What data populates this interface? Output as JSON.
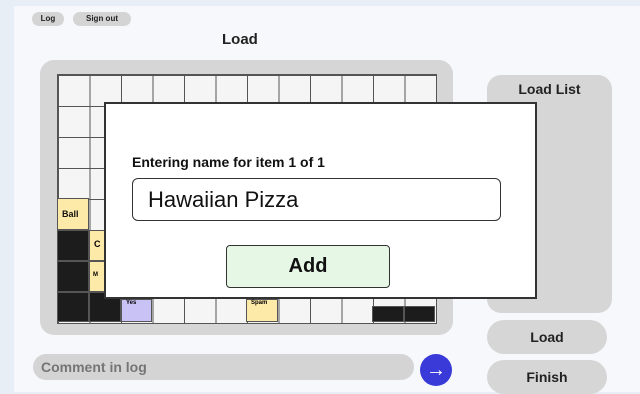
{
  "top_bar": {
    "log_label": "Log",
    "sign_out_label": "Sign out"
  },
  "main": {
    "title": "Load"
  },
  "grid": {
    "ball_label": "Ball",
    "partial_label_1": "C",
    "partial_label_2": "M",
    "partial_label_3": "Yes",
    "partial_label_4": "Spam"
  },
  "load_list": {
    "title": "Load List"
  },
  "actions": {
    "load_label": "Load",
    "finish_label": "Finish"
  },
  "comment": {
    "placeholder": "Comment in log",
    "send_icon": "arrow-right-icon"
  },
  "dialog": {
    "prompt": "Entering name for item 1 of 1",
    "input_value": "Hawaiian Pizza",
    "add_label": "Add"
  },
  "colors": {
    "accent": "#3a3ad8",
    "add_bg": "#e6f7e6",
    "ball_cell": "#fde9a8",
    "purple_cell": "#c9c3f5"
  }
}
